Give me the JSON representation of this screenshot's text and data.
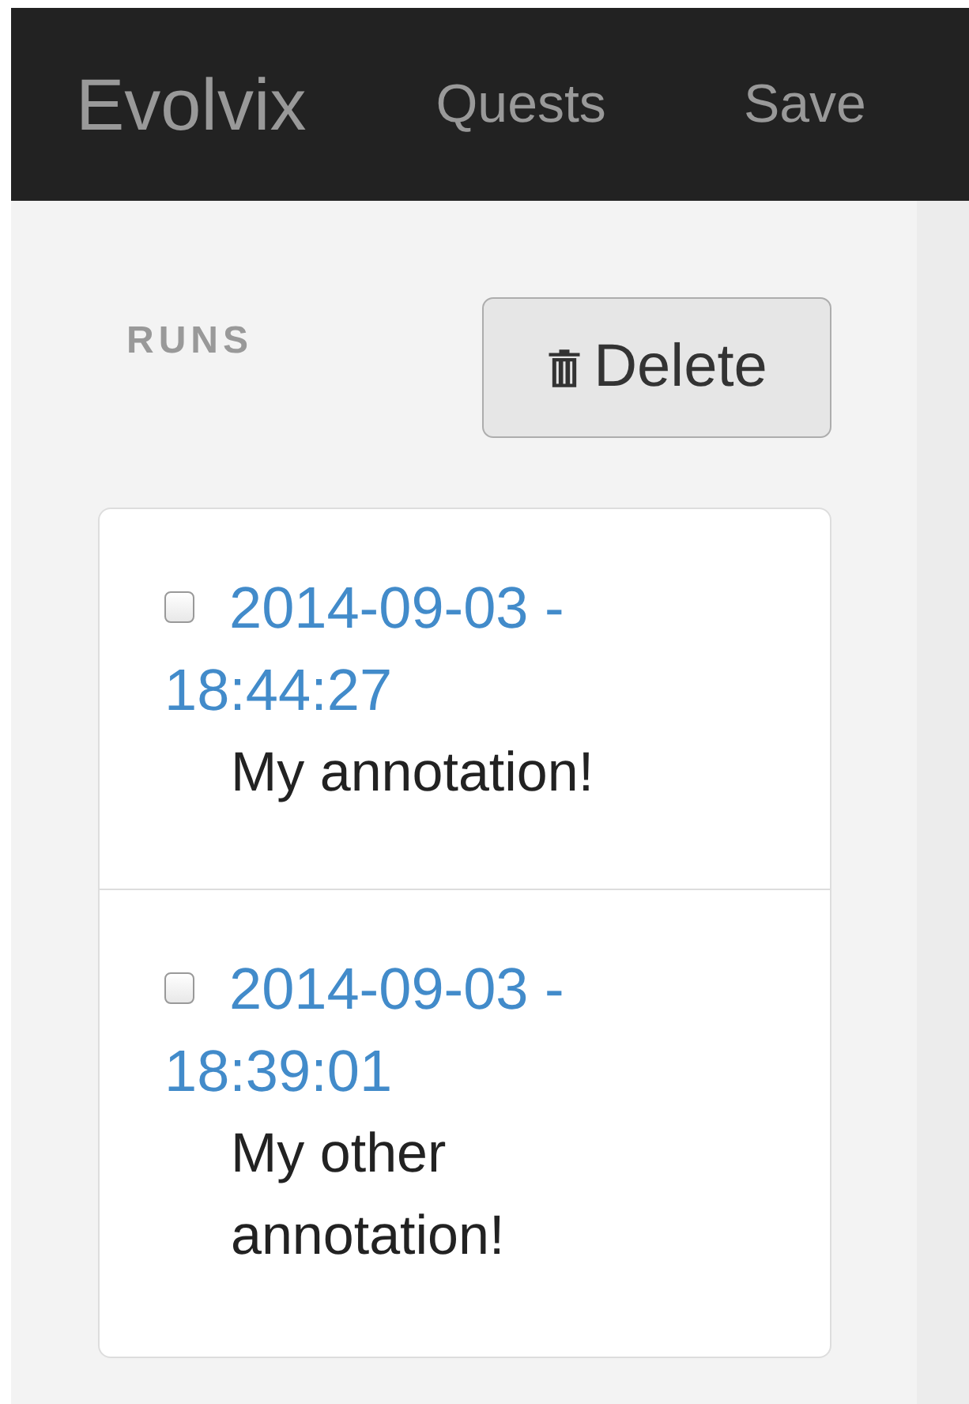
{
  "navbar": {
    "brand": "Evolvix",
    "links": [
      {
        "label": "Quests"
      },
      {
        "label": "Save"
      }
    ]
  },
  "runs": {
    "heading": "RUNS",
    "delete_button": "Delete",
    "items": [
      {
        "checked": false,
        "timestamp": "2014-09-03 - 18:44:27",
        "annotation": "My annotation!"
      },
      {
        "checked": false,
        "timestamp": "2014-09-03 - 18:39:01",
        "annotation": "My other annotation!"
      }
    ]
  }
}
